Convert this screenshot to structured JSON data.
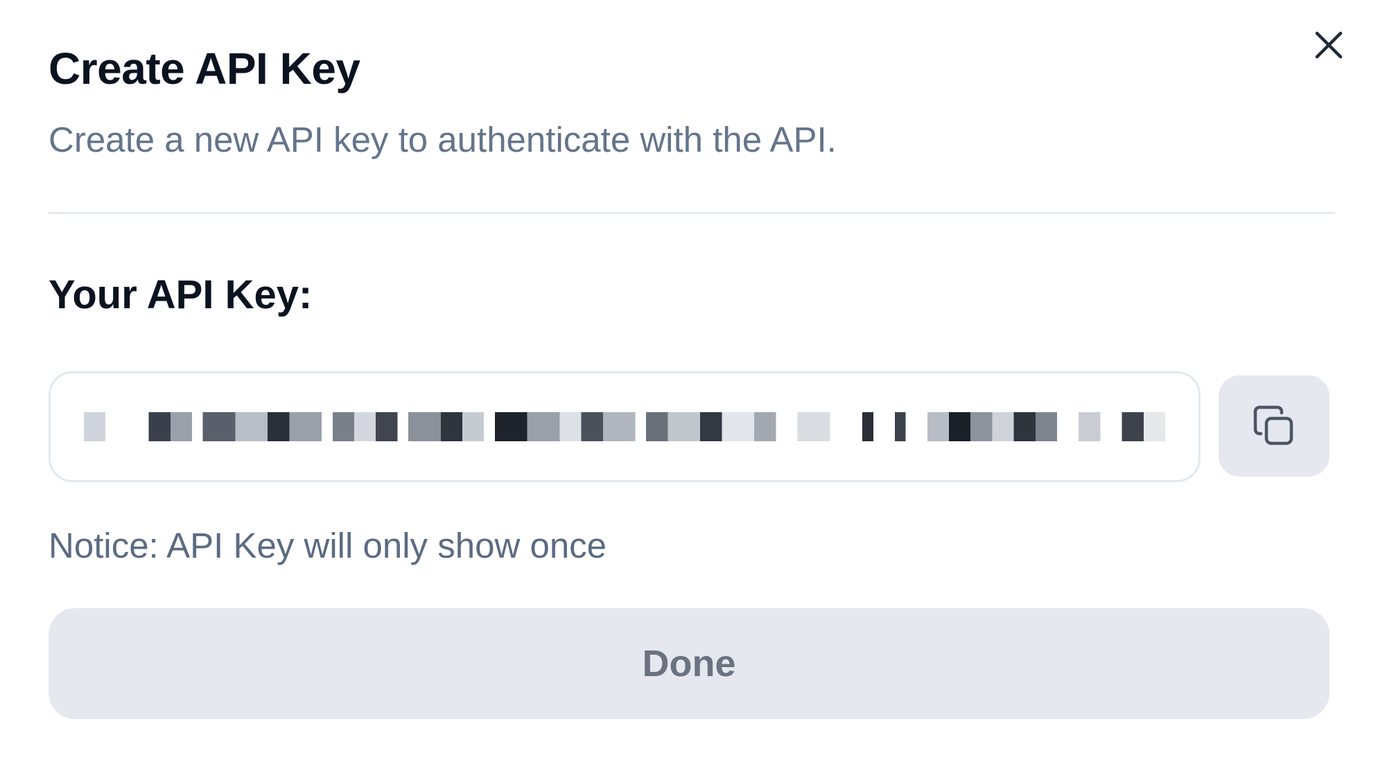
{
  "dialog": {
    "title": "Create API Key",
    "subtitle": "Create a new API key to authenticate with the API.",
    "close_icon": "close-icon"
  },
  "key_section": {
    "label": "Your API Key:",
    "key_value": "sk-••••••••••••••••••••••••••••••••••••••••••••••••••",
    "copy_icon": "copy-icon"
  },
  "notice": "Notice: API Key will only show once",
  "actions": {
    "done_label": "Done"
  },
  "colors": {
    "background": "#ffffff",
    "title_text": "#0b1220",
    "muted_text": "#64748b",
    "button_bg": "#e5e8ee",
    "border": "#e2e8f0"
  }
}
